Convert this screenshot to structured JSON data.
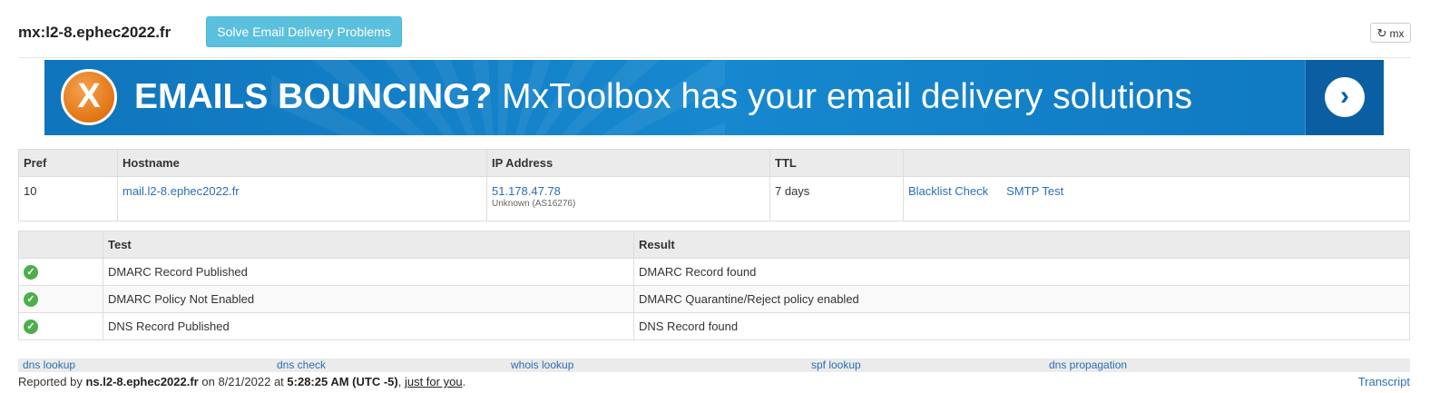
{
  "header": {
    "title": "mx:l2-8.ephec2022.fr",
    "solve_button": "Solve Email Delivery Problems",
    "refresh_button": "mx"
  },
  "banner": {
    "x_letter": "X",
    "headline_bold": "EMAILS BOUNCING?",
    "headline_rest": "MxToolbox has your email delivery solutions"
  },
  "mx_table": {
    "headers": [
      "Pref",
      "Hostname",
      "IP Address",
      "TTL",
      ""
    ],
    "row": {
      "pref": "10",
      "hostname": "mail.l2-8.ephec2022.fr",
      "ip": "51.178.47.78",
      "asn": "Unknown (AS16276)",
      "ttl": "7 days",
      "blacklist": "Blacklist Check",
      "smtp": "SMTP Test"
    }
  },
  "test_table": {
    "headers": [
      "",
      "Test",
      "Result"
    ],
    "rows": [
      {
        "test": "DMARC Record Published",
        "result": "DMARC Record found"
      },
      {
        "test": "DMARC Policy Not Enabled",
        "result": "DMARC Quarantine/Reject policy enabled"
      },
      {
        "test": "DNS Record Published",
        "result": "DNS Record found"
      }
    ]
  },
  "footer": {
    "links": [
      "dns lookup",
      "dns check",
      "whois lookup",
      "spf lookup",
      "dns propagation"
    ],
    "reported_prefix": "Reported by",
    "reported_by": "ns.l2-8.ephec2022.fr",
    "on": "on",
    "date": "8/21/2022",
    "at": "at",
    "time": "5:28:25 AM (UTC -5)",
    "just_for_you": "just for you",
    "transcript": "Transcript"
  },
  "colors": {
    "accent_button": "#5bc0de",
    "link": "#2a6fb5",
    "banner_blue": "#1688cf",
    "banner_orange": "#e27514",
    "check_green": "#4cae4c"
  }
}
